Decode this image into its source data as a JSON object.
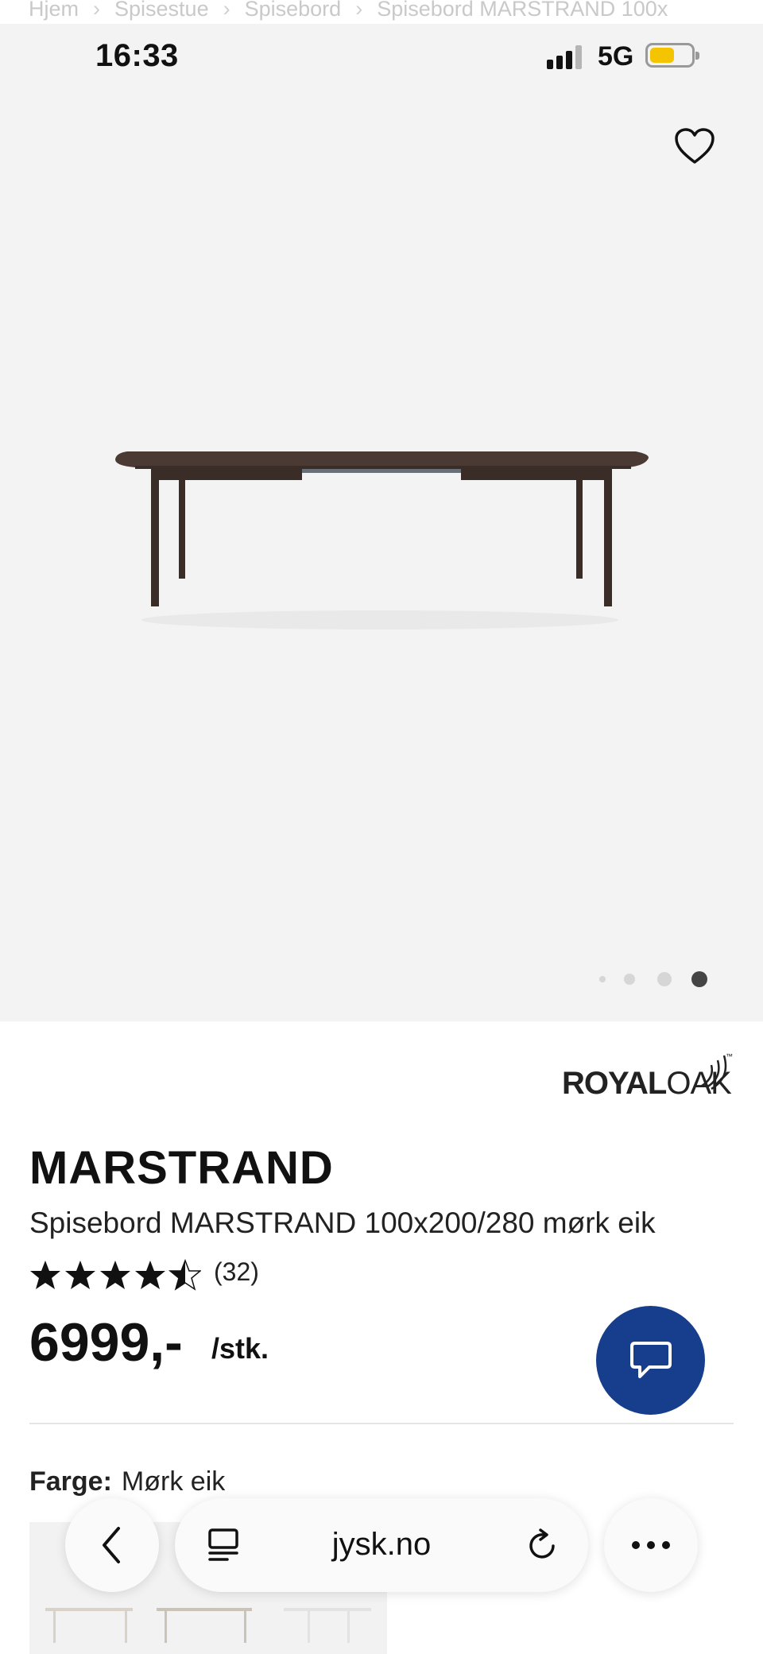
{
  "breadcrumb": [
    {
      "label": "Hjem"
    },
    {
      "label": "Spisestue"
    },
    {
      "label": "Spisebord"
    },
    {
      "label": "Spisebord MARSTRAND 100x"
    }
  ],
  "status_bar": {
    "time": "16:33",
    "network": "5G",
    "signal_icon": "cellular-signal-icon",
    "battery_icon": "battery-icon",
    "battery_color": "#f5c400"
  },
  "gallery": {
    "favorite_icon": "heart-outline-icon",
    "image_count": 4,
    "active_index": 3,
    "background": "#f3f3f3"
  },
  "product": {
    "brand_part1": "ROYAL",
    "brand_part2": "OAK",
    "brand_tm": "™",
    "name": "MARSTRAND",
    "description": "Spisebord MARSTRAND 100x200/280 mørk eik",
    "rating": 4.5,
    "rating_count": "(32)",
    "price": "6999,-",
    "unit": "/stk.",
    "color_label": "Farge:",
    "color_value": "Mørk eik"
  },
  "chat": {
    "icon": "chat-bubble-icon",
    "color": "#163e8c"
  },
  "browser": {
    "url": "jysk.no",
    "back_icon": "chevron-left-icon",
    "tabs_icon": "tabs-icon",
    "reload_icon": "reload-icon",
    "more_icon": "more-horizontal-icon"
  }
}
